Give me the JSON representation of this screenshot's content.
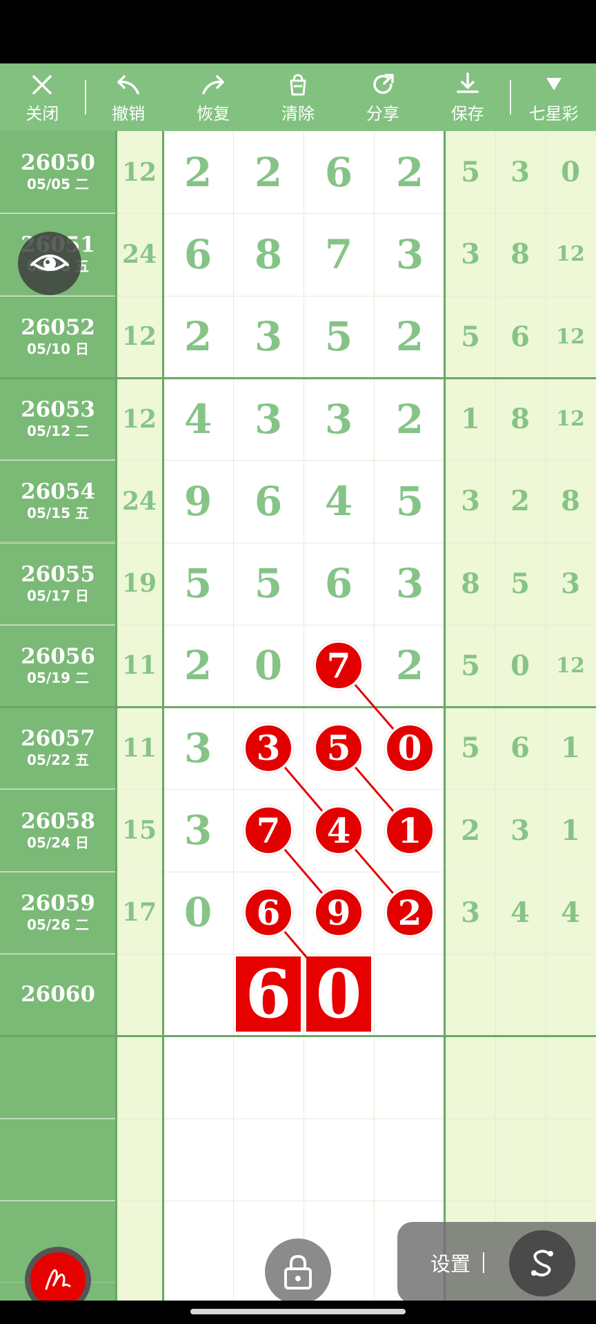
{
  "toolbar": {
    "items": [
      {
        "label": "关闭",
        "icon": "close-icon"
      },
      {
        "label": "撤销",
        "icon": "undo-icon"
      },
      {
        "label": "恢复",
        "icon": "redo-icon"
      },
      {
        "label": "清除",
        "icon": "clear-icon"
      },
      {
        "label": "分享",
        "icon": "share-icon"
      },
      {
        "label": "保存",
        "icon": "save-icon"
      },
      {
        "label": "七星彩",
        "icon": "dropdown-triangle-icon"
      }
    ]
  },
  "rows": [
    {
      "issue": "26050",
      "date": "05/05 二",
      "sum": "12",
      "digits": [
        "2",
        "2",
        "6",
        "2"
      ],
      "tail": [
        "5",
        "3",
        "0"
      ]
    },
    {
      "issue": "26051",
      "date": "05/08 五",
      "sum": "24",
      "digits": [
        "6",
        "8",
        "7",
        "3"
      ],
      "tail": [
        "3",
        "8",
        "12"
      ]
    },
    {
      "issue": "26052",
      "date": "05/10 日",
      "sum": "12",
      "digits": [
        "2",
        "3",
        "5",
        "2"
      ],
      "tail": [
        "5",
        "6",
        "12"
      ]
    },
    {
      "issue": "26053",
      "date": "05/12 二",
      "sum": "12",
      "digits": [
        "4",
        "3",
        "3",
        "2"
      ],
      "tail": [
        "1",
        "8",
        "12"
      ]
    },
    {
      "issue": "26054",
      "date": "05/15 五",
      "sum": "24",
      "digits": [
        "9",
        "6",
        "4",
        "5"
      ],
      "tail": [
        "3",
        "2",
        "8"
      ]
    },
    {
      "issue": "26055",
      "date": "05/17 日",
      "sum": "19",
      "digits": [
        "5",
        "5",
        "6",
        "3"
      ],
      "tail": [
        "8",
        "5",
        "3"
      ]
    },
    {
      "issue": "26056",
      "date": "05/19 二",
      "sum": "11",
      "digits": [
        "2",
        "0",
        "7",
        "2"
      ],
      "tail": [
        "5",
        "0",
        "12"
      ]
    },
    {
      "issue": "26057",
      "date": "05/22 五",
      "sum": "11",
      "digits": [
        "3",
        "3",
        "5",
        "0"
      ],
      "tail": [
        "5",
        "6",
        "1"
      ]
    },
    {
      "issue": "26058",
      "date": "05/24 日",
      "sum": "15",
      "digits": [
        "3",
        "7",
        "4",
        "1"
      ],
      "tail": [
        "2",
        "3",
        "1"
      ]
    },
    {
      "issue": "26059",
      "date": "05/26 二",
      "sum": "17",
      "digits": [
        "0",
        "6",
        "9",
        "2"
      ],
      "tail": [
        "3",
        "4",
        "4"
      ]
    },
    {
      "issue": "26060",
      "date": "",
      "sum": "",
      "digits": [
        "",
        "",
        "",
        ""
      ],
      "tail": [
        "",
        "",
        ""
      ]
    }
  ],
  "highlights": [
    {
      "row": 6,
      "col": 2
    },
    {
      "row": 7,
      "col": 1
    },
    {
      "row": 7,
      "col": 2
    },
    {
      "row": 7,
      "col": 3
    },
    {
      "row": 8,
      "col": 1
    },
    {
      "row": 8,
      "col": 2
    },
    {
      "row": 8,
      "col": 3
    },
    {
      "row": 9,
      "col": 1
    },
    {
      "row": 9,
      "col": 2
    },
    {
      "row": 9,
      "col": 3
    }
  ],
  "links": [
    [
      [
        6,
        2
      ],
      [
        7,
        3
      ]
    ],
    [
      [
        7,
        1
      ],
      [
        8,
        2
      ]
    ],
    [
      [
        7,
        2
      ],
      [
        8,
        3
      ]
    ],
    [
      [
        8,
        1
      ],
      [
        9,
        2
      ]
    ],
    [
      [
        8,
        2
      ],
      [
        9,
        3
      ]
    ],
    [
      [
        9,
        1
      ],
      [
        10,
        2
      ]
    ]
  ],
  "prediction": {
    "row": 10,
    "cells": [
      {
        "col": 1,
        "value": "6"
      },
      {
        "col": 2,
        "value": "0"
      }
    ]
  },
  "settings": {
    "label": "设置",
    "button_icon": "s-logo-icon"
  },
  "colors": {
    "green": "#83c180",
    "dark_green": "#6aa866",
    "digit_green": "#85c486",
    "pale": "#eef7d6",
    "red": "#e30000"
  }
}
